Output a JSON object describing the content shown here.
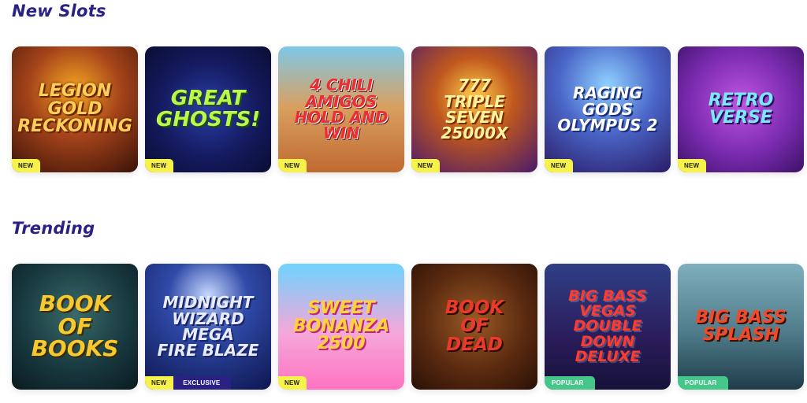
{
  "sections": [
    {
      "title": "New Slots",
      "games": [
        {
          "logo": "Legion\nGold\nReckoning",
          "badges": [
            "NEW"
          ]
        },
        {
          "logo": "Great\nGhosts!",
          "badges": [
            "NEW"
          ]
        },
        {
          "logo": "4 Chili\nAmigos\nHold and Win",
          "badges": [
            "NEW"
          ]
        },
        {
          "logo": "777\nTriple\nSeven\n25000X",
          "badges": [
            "NEW"
          ]
        },
        {
          "logo": "Raging\nGods\nOlympus 2",
          "badges": [
            "NEW"
          ]
        },
        {
          "logo": "Retro\nVerse",
          "badges": [
            "NEW"
          ]
        }
      ]
    },
    {
      "title": "Trending",
      "games": [
        {
          "logo": "Book\nof\nBooks",
          "badges": []
        },
        {
          "logo": "Midnight\nWizard\nMega\nFire Blaze",
          "badges": [
            "NEW",
            "EXCLUSIVE"
          ]
        },
        {
          "logo": "Sweet\nBonanza\n2500",
          "badges": [
            "NEW"
          ]
        },
        {
          "logo": "Book\nof\nDead",
          "badges": []
        },
        {
          "logo": "Big Bass\nVegas\nDouble Down\nDeluxe",
          "badges": [
            "POPULAR"
          ]
        },
        {
          "logo": "Big Bass\nSplash",
          "badges": [
            "POPULAR"
          ]
        }
      ]
    }
  ],
  "badge_colors": {
    "NEW": "#f7f24a",
    "EXCLUSIVE": "#2a2185",
    "POPULAR": "#45c78a"
  }
}
